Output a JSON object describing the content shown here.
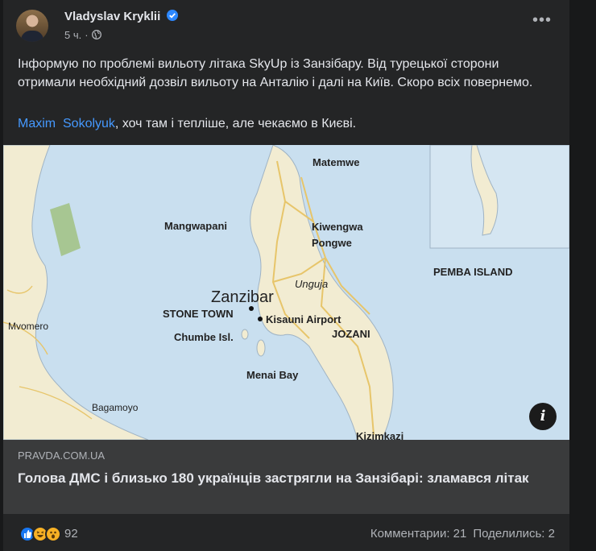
{
  "post": {
    "author": "Vladyslav Kryklii",
    "time": "5 ч.",
    "separator": "·",
    "text": "Інформую по проблемі вильоту літака SkyUp із Занзібару. Від турецької сторони отримали необхідний дозвіл вильоту на Анталію і далі на Київ. Скоро всіх повернемо.",
    "mention_first": "Maxim",
    "mention_last": "Sokolyuk",
    "comment_rest": ", хоч там і тепліше, але чекаємо в Києві.",
    "more_label": "•••"
  },
  "map": {
    "labels": {
      "matemwe": "Matemwe",
      "mangwapani": "Mangwapani",
      "kiwengwa": "Kiwengwa",
      "pongwe": "Pongwe",
      "pemba": "PEMBA ISLAND",
      "unguja": "Unguja",
      "zanzibar": "Zanzibar",
      "stone_town": "STONE TOWN",
      "kisauni": "Kisauni Airport",
      "mvomero": "Mvomero",
      "chumbe": "Chumbe Isl.",
      "jozani": "JOZANI",
      "menai": "Menai Bay",
      "bagamoyo": "Bagamoyo",
      "kizimkazi": "Kizimkazi"
    },
    "colors": {
      "sea": "#c9dfef",
      "land": "#f2ecd2",
      "road": "#e7c56a",
      "park": "#9fbf7a"
    }
  },
  "link": {
    "domain": "PRAVDA.COM.UA",
    "title": "Голова ДМС і близько 180 українців застрягли на Занзібарі: зламався літак",
    "info_label": "i"
  },
  "footer": {
    "reaction_count": "92",
    "comments": "Комментарии: 21",
    "shares": "Поделились: 2"
  },
  "colors": {
    "card_bg": "#242526",
    "link_blue": "#4599ff",
    "like_blue": "#1877f2",
    "reaction_yellow": "#f7b125"
  }
}
